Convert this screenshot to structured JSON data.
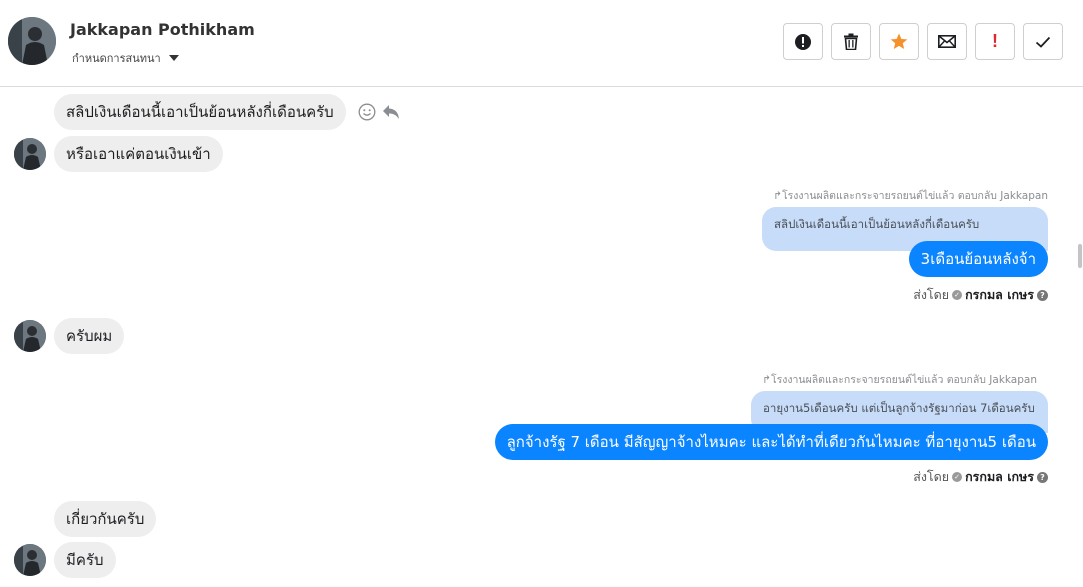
{
  "header": {
    "contact_name": "Jakkapan Pothikham",
    "assign_label": "กำหนดการสนทนา",
    "toolbar": {
      "alert_icon": "alert-circle-icon",
      "delete_icon": "trash-icon",
      "star_icon": "star-icon",
      "mail_icon": "envelope-icon",
      "important_label": "!",
      "done_icon": "checkmark-icon"
    }
  },
  "colors": {
    "incoming_bubble": "#eeeeee",
    "outgoing_bubble": "#0a84ff",
    "quote_bubble": "#c7dcf9",
    "star": "#f5912b",
    "important": "#e0282e"
  },
  "messages": {
    "in1": "สลิปเงินเดือนนี้เอาเป็นย้อนหลังกี่เดือนครับ",
    "in2": "หรือเอาแค่ตอนเงินเข้า",
    "reply1": {
      "meta": "↱โรงงานผลิตและกระจายรถยนต์ไข่แล้ว ตอบกลับ Jakkapan",
      "quote": "สลิปเงินเดือนนี้เอาเป็นย้อนหลังกี่เดือนครับ",
      "text": "3เดือนย้อนหลังจ้า",
      "sent_by_label": "ส่งโดย",
      "agent": "กรกมล เกษร"
    },
    "in3": "ครับผม",
    "reply2": {
      "meta": "↱โรงงานผลิตและกระจายรถยนต์ไข่แล้ว ตอบกลับ Jakkapan",
      "quote": "อายุงาน5เดือนครับ แต่เป็นลูกจ้างรัฐมาก่อน 7เดือนครับ",
      "text": "ลูกจ้างรัฐ 7 เดือน มีสัญญาจ้างไหมคะ  และได้ทำที่เดียวกันไหมคะ ที่อายุงาน5 เดือน",
      "sent_by_label": "ส่งโดย",
      "agent": "กรกมล เกษร"
    },
    "in4": "เกี่ยวกันครับ",
    "in5": "มีครับ"
  }
}
